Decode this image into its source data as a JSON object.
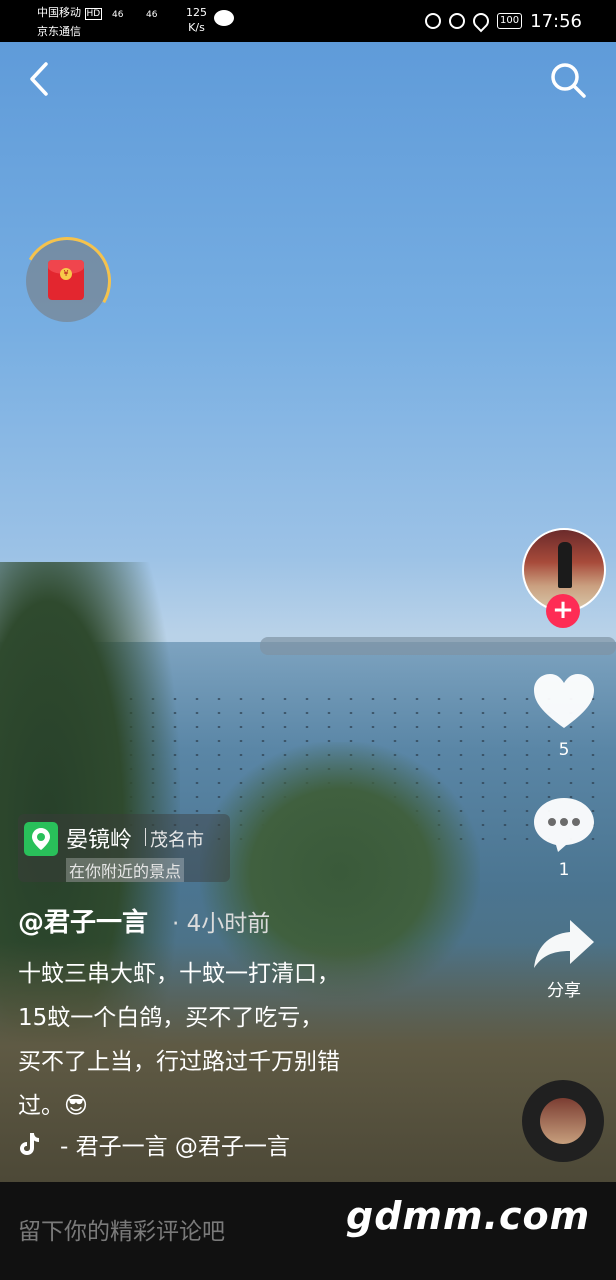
{
  "status_bar": {
    "carrier1": "中国移动",
    "hd": "HD",
    "carrier2": "京东通信",
    "signal1": "46",
    "signal2": "46",
    "speed_value": "125",
    "speed_unit": "K/s",
    "battery": "100",
    "time": "17:56"
  },
  "location": {
    "name": "晏镜岭",
    "city": "茂名市",
    "nearby": "在你附近的景点"
  },
  "post": {
    "author": "@君子一言",
    "time": "· 4小时前",
    "caption_lines": [
      "十蚊三串大虾，十蚊一打清口，",
      "15蚊一个白鸽，买不了吃亏，",
      "买不了上当，行过路过千万别错",
      "过。😎"
    ]
  },
  "music": {
    "text": "- 君子一言    @君子一言"
  },
  "actions": {
    "likes": "5",
    "comments": "1",
    "share": "分享"
  },
  "comment_bar": {
    "placeholder": "留下你的精彩评论吧",
    "watermark": "gdmm.com"
  },
  "colors": {
    "follow": "#fe2c55",
    "location_pin": "#29c05a",
    "redpacket": "#e3262f"
  }
}
